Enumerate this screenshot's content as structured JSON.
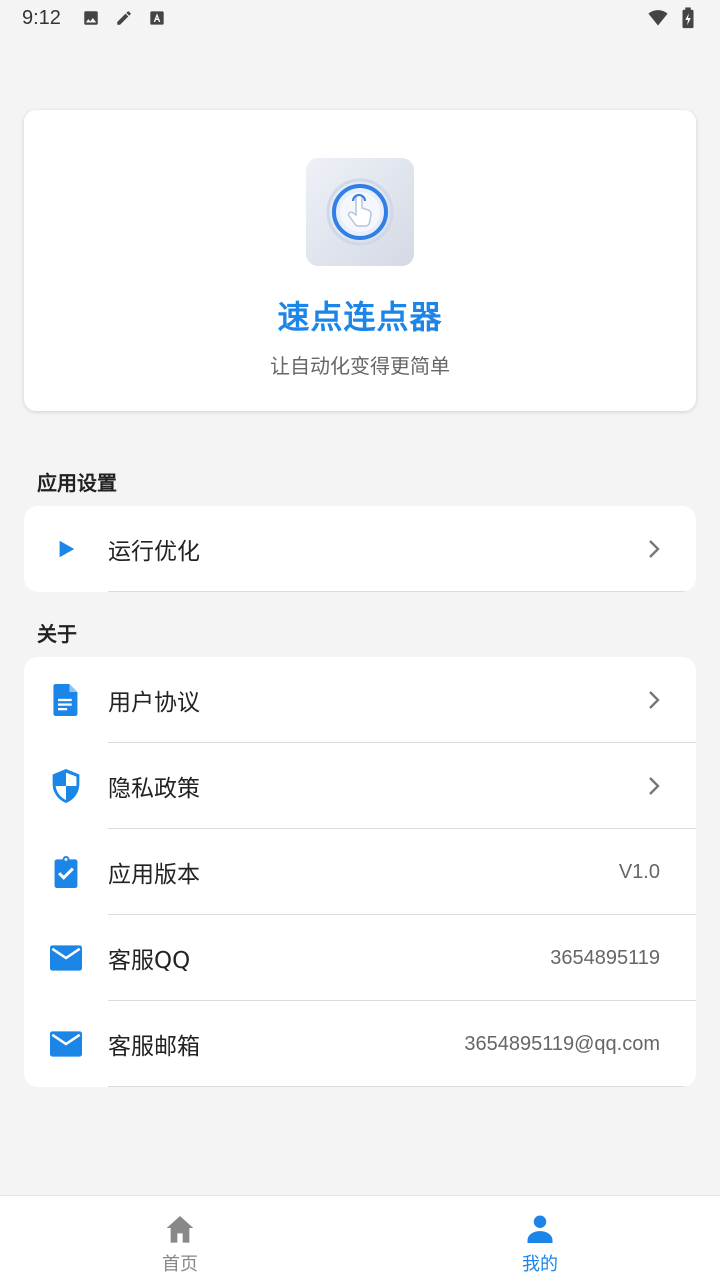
{
  "status_bar": {
    "time": "9:12",
    "left_icons": [
      "image-icon",
      "pencil-icon",
      "font-icon"
    ],
    "right_icons": [
      "wifi-icon",
      "battery-charging-icon"
    ]
  },
  "header": {
    "app_name": "速点连点器",
    "slogan": "让自动化变得更简单",
    "logo_icon": "tap-hand-icon"
  },
  "sections": {
    "app_settings": {
      "title": "应用设置",
      "items": [
        {
          "label": "运行优化",
          "icon": "play-icon"
        }
      ]
    },
    "about": {
      "title": "关于",
      "items": [
        {
          "label": "用户协议",
          "icon": "document-icon"
        },
        {
          "label": "隐私政策",
          "icon": "shield-icon"
        },
        {
          "label": "应用版本",
          "icon": "clipboard-check-icon",
          "value": "V1.0"
        },
        {
          "label": "客服QQ",
          "icon": "mail-icon",
          "value": "3654895119"
        },
        {
          "label": "客服邮箱",
          "icon": "mail-icon",
          "value": "3654895119@qq.com"
        }
      ]
    }
  },
  "bottom_nav": {
    "items": [
      {
        "label": "首页",
        "icon": "home-icon",
        "active": false
      },
      {
        "label": "我的",
        "icon": "person-icon",
        "active": true
      }
    ]
  },
  "colors": {
    "accent": "#1b86e8",
    "background": "#f4f4f4",
    "inactive": "#888888"
  }
}
